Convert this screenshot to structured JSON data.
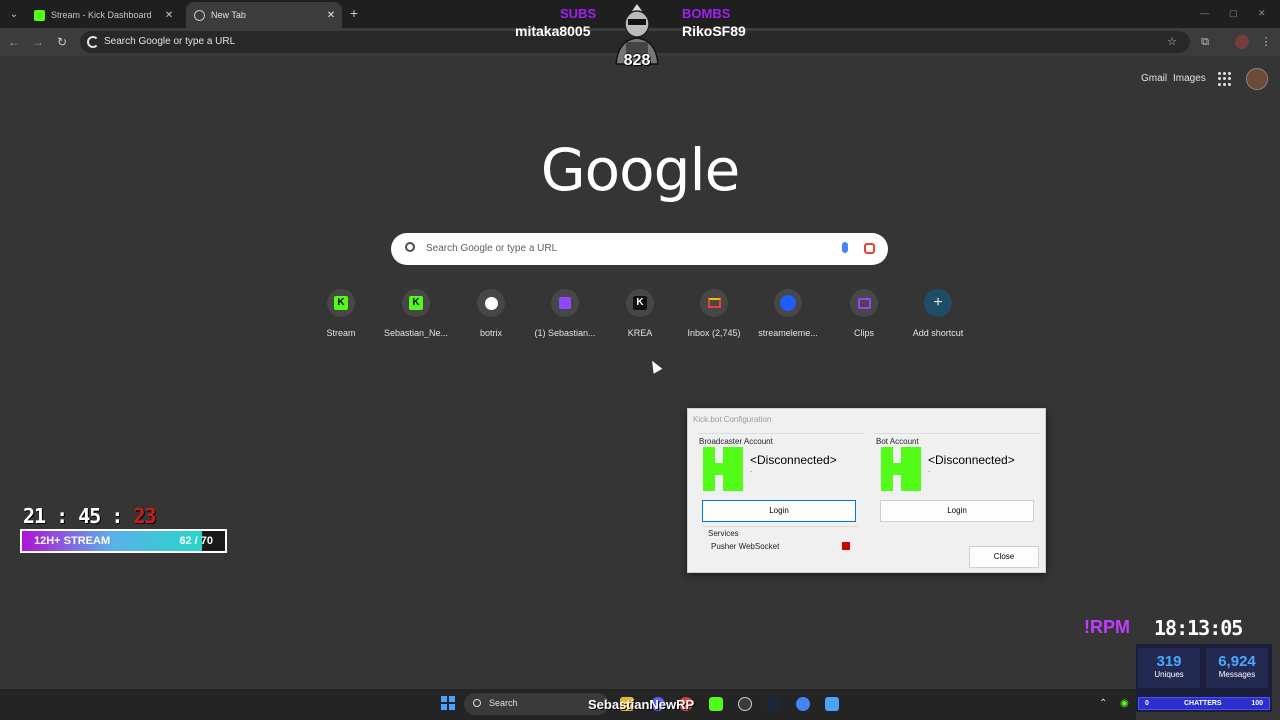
{
  "tabs": [
    {
      "title": "Stream - Kick Dashboard",
      "icon": "kick-icon",
      "active": false
    },
    {
      "title": "New Tab",
      "icon": "globe-icon",
      "active": true
    }
  ],
  "omnibox": {
    "placeholder": "Search Google or type a URL"
  },
  "overlay_top": {
    "subs_label": "SUBS",
    "subs_name": "mitaka8005",
    "bombs_label": "BOMBS",
    "bombs_name": "RikoSF89",
    "count": "828"
  },
  "google": {
    "links": [
      "Gmail",
      "Images"
    ],
    "logo": "Google",
    "search_placeholder": "Search Google or type a URL",
    "shortcuts": [
      {
        "label": "Stream",
        "icon": "kick-icon"
      },
      {
        "label": "Sebastian_Ne...",
        "icon": "kick-icon"
      },
      {
        "label": "botrix",
        "icon": "botrix-icon"
      },
      {
        "label": "(1) Sebastian...",
        "icon": "twitch-icon"
      },
      {
        "label": "KREA",
        "icon": "krea-icon"
      },
      {
        "label": "Inbox (2,745)",
        "icon": "gmail-icon"
      },
      {
        "label": "streameleme...",
        "icon": "streamelements-icon"
      },
      {
        "label": "Clips",
        "icon": "clips-icon"
      },
      {
        "label": "Add shortcut",
        "icon": "plus-icon"
      }
    ]
  },
  "timer": {
    "h": "21",
    "m": "45",
    "s": "23"
  },
  "stream_goal": {
    "label": "12H+ STREAM",
    "count": "62 / 70",
    "progress": 0.886
  },
  "dialog": {
    "title": "Kick.bot Configuration",
    "broadcaster": {
      "title": "Broadcaster Account",
      "status": "<Disconnected>",
      "sub": "-",
      "login": "Login"
    },
    "bot": {
      "title": "Bot Account",
      "status": "<Disconnected>",
      "sub": "-",
      "login": "Login"
    },
    "services_title": "Services",
    "service_name": "Pusher WebSocket",
    "service_status_color": "#d00000",
    "close": "Close"
  },
  "rpm": "!RPM",
  "clock": "18:13:05",
  "stats": {
    "uniques_value": "319",
    "uniques_label": "Uniques",
    "messages_value": "6,924",
    "messages_label": "Messages",
    "chatters_min": "0",
    "chatters_label": "CHATTERS",
    "chatters_max": "100"
  },
  "taskbar": {
    "search": "Search",
    "streamer": "SebastianNewRP"
  }
}
